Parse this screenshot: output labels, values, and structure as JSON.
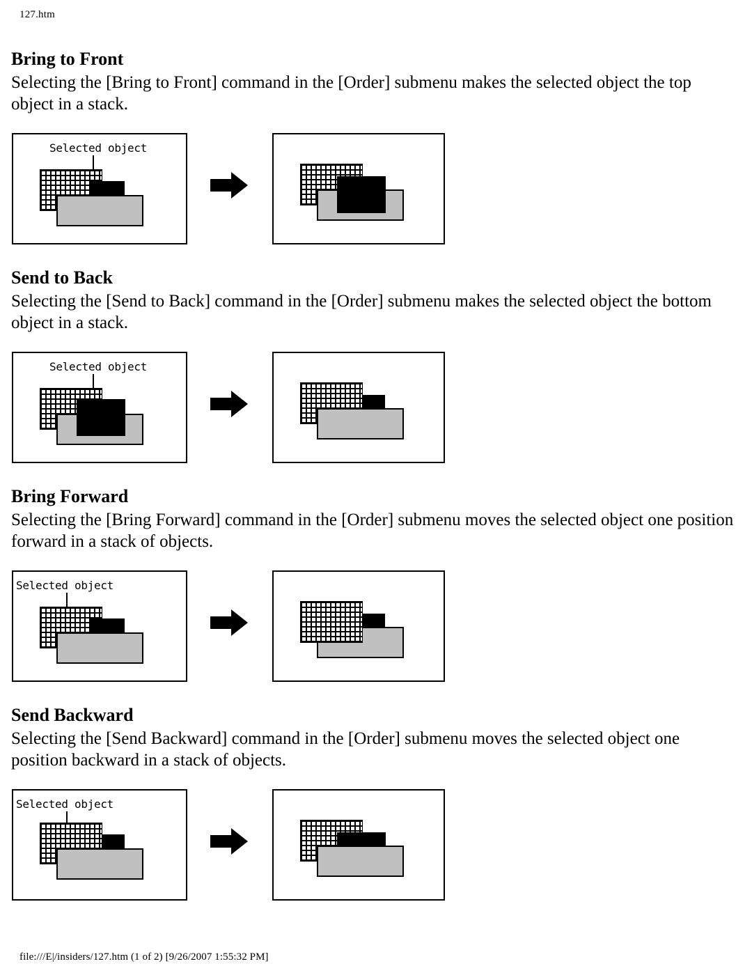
{
  "document": {
    "header": "127.htm",
    "footer": "file:///E|/insiders/127.htm (1 of 2) [9/26/2007 1:55:32 PM]",
    "label_selected_object": "Selected object",
    "colors": {
      "page_background": "#ffffff",
      "text": "#000000",
      "gray_object": "#c0c0c0",
      "black_object": "#000000",
      "grid_object_line": "#000000",
      "panel_border": "#000000"
    }
  },
  "sections": [
    {
      "id": "bring-to-front",
      "title": "Bring to Front",
      "body": "Selecting the [Bring to Front] command in the [Order] submenu makes the selected object the top object in a stack.",
      "label": "Selected object",
      "label_target": "black-object",
      "before_stack_back_to_front": [
        "grid-object",
        "black-object",
        "gray-object"
      ],
      "after_stack_back_to_front": [
        "grid-object",
        "gray-object",
        "black-object"
      ]
    },
    {
      "id": "send-to-back",
      "title": "Send to Back",
      "body": "Selecting the [Send to Back] command in the [Order] submenu makes the selected object the bottom object in a stack.",
      "label": "Selected object",
      "label_target": "black-object",
      "before_stack_back_to_front": [
        "grid-object",
        "gray-object",
        "black-object"
      ],
      "after_stack_back_to_front": [
        "black-object",
        "grid-object",
        "gray-object"
      ]
    },
    {
      "id": "bring-forward",
      "title": "Bring Forward",
      "body": "Selecting the [Bring Forward] command in the [Order] submenu moves the selected object one position forward in a stack of objects.",
      "label": "Selected object",
      "label_target": "grid-object",
      "before_stack_back_to_front": [
        "grid-object",
        "black-object",
        "gray-object"
      ],
      "after_stack_back_to_front": [
        "black-object",
        "gray-object",
        "grid-object"
      ]
    },
    {
      "id": "send-backward",
      "title": "Send Backward",
      "body": "Selecting the [Send Backward] command in the [Order] submenu moves the selected object one position backward in a stack of objects.",
      "label": "Selected object",
      "label_target": "grid-object",
      "before_stack_back_to_front": [
        "black-object",
        "grid-object",
        "gray-object"
      ],
      "after_stack_back_to_front": [
        "grid-object",
        "black-object",
        "gray-object"
      ]
    }
  ]
}
